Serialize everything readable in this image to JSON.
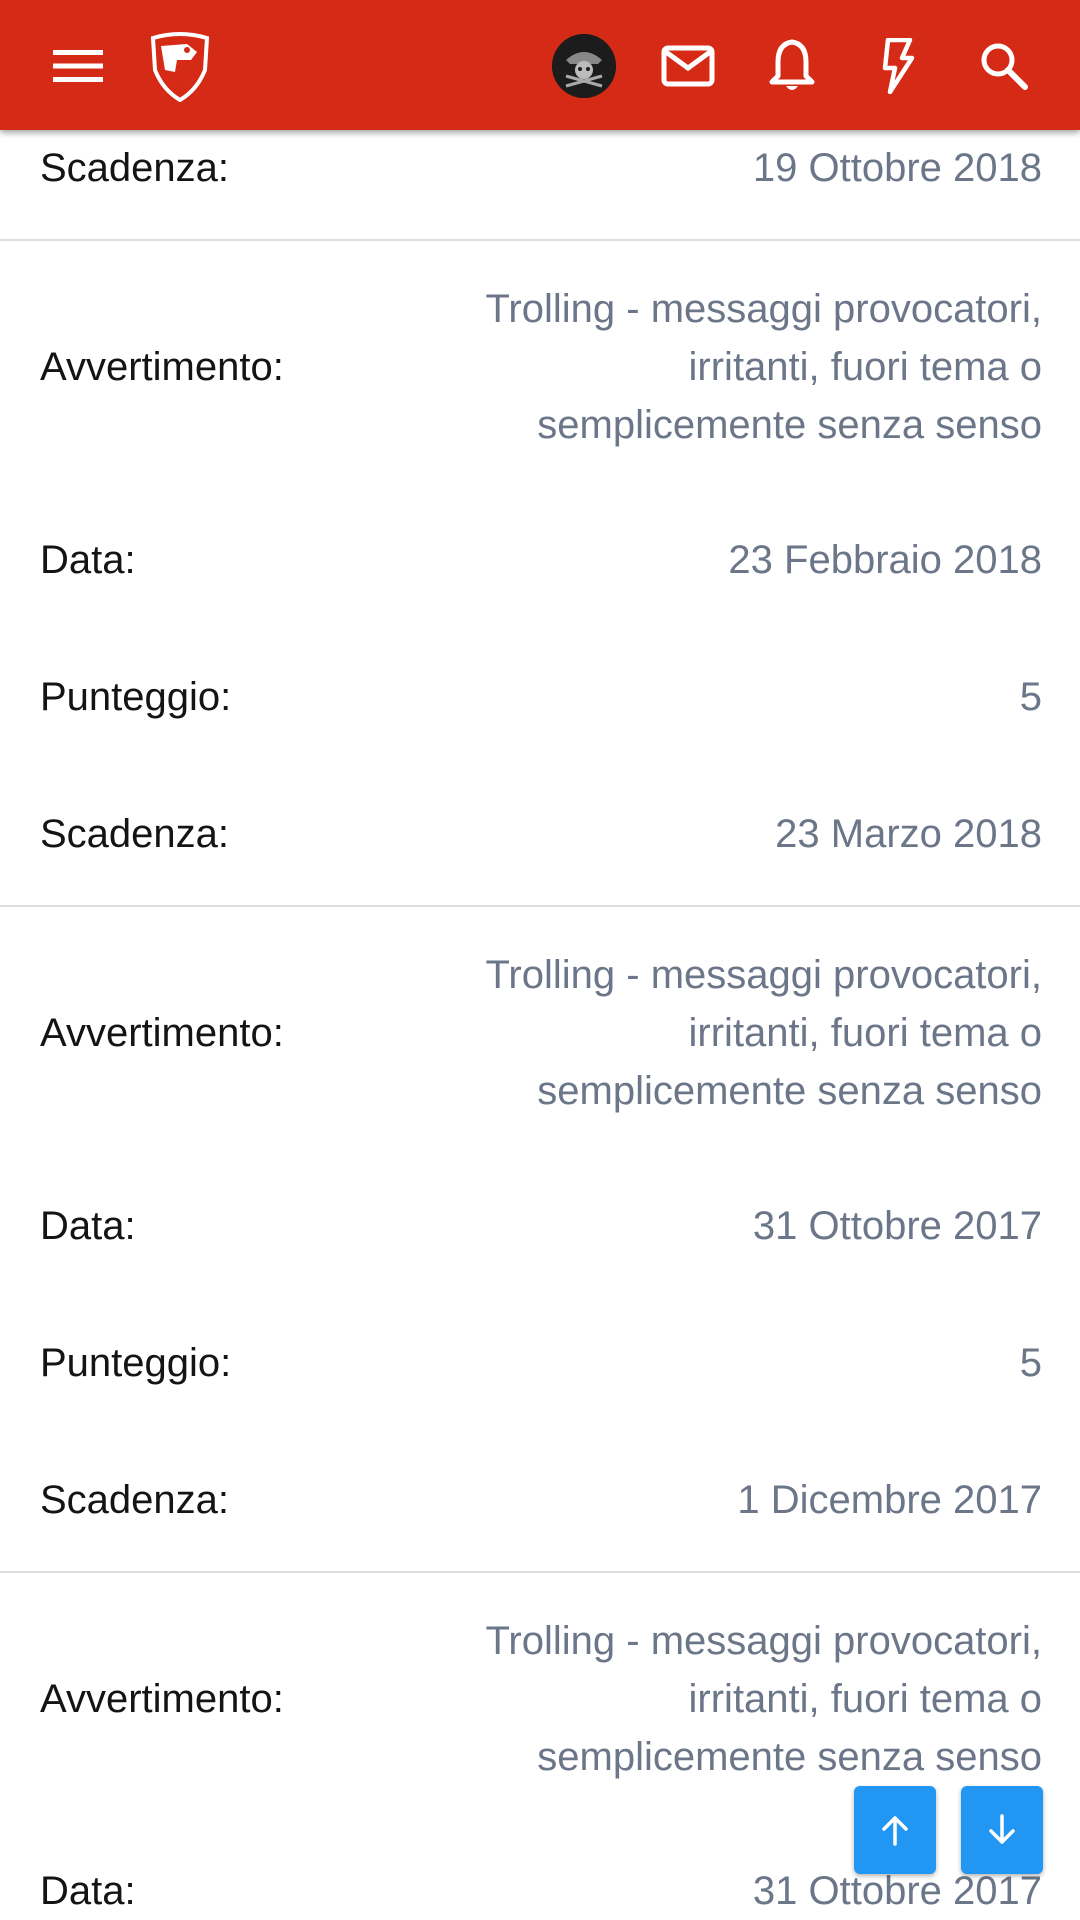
{
  "header": {
    "background": "#d42a16",
    "icons": [
      "menu-icon",
      "logo-icon",
      "avatar",
      "mail-icon",
      "bell-icon",
      "bolt-icon",
      "search-icon"
    ]
  },
  "warnings": {
    "first_partial": {
      "expiry_label": "Scadenza:",
      "expiry_value": "19 Ottobre 2018"
    },
    "entries": [
      {
        "warning_label": "Avvertimento:",
        "warning_line1": "Trolling - messaggi provocatori,",
        "warning_line2": "irritanti, fuori tema o",
        "warning_line3": "semplicemente senza senso",
        "date_label": "Data:",
        "date_value": "23 Febbraio 2018",
        "points_label": "Punteggio:",
        "points_value": "5",
        "expiry_label": "Scadenza:",
        "expiry_value": "23 Marzo 2018"
      },
      {
        "warning_label": "Avvertimento:",
        "warning_line1": "Trolling - messaggi provocatori,",
        "warning_line2": "irritanti, fuori tema o",
        "warning_line3": "semplicemente senza senso",
        "date_label": "Data:",
        "date_value": "31 Ottobre 2017",
        "points_label": "Punteggio:",
        "points_value": "5",
        "expiry_label": "Scadenza:",
        "expiry_value": "1 Dicembre 2017"
      },
      {
        "warning_label": "Avvertimento:",
        "warning_line1": "Trolling - messaggi provocatori,",
        "warning_line2": "irritanti, fuori tema o",
        "warning_line3": "semplicemente senza senso",
        "date_label": "Data:",
        "date_value": "31 Ottobre 2017"
      }
    ]
  },
  "scroll_buttons": {
    "color": "#2196f3",
    "up_icon": "arrow-up-icon",
    "down_icon": "arrow-down-icon"
  }
}
